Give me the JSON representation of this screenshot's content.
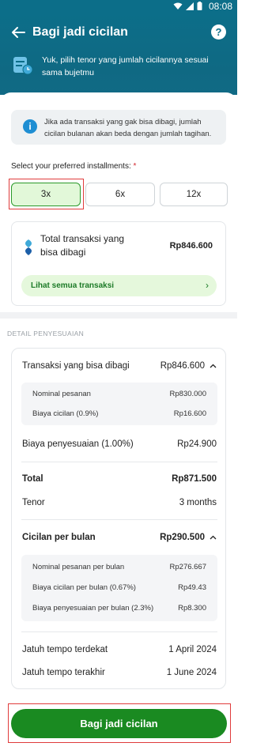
{
  "status_bar": {
    "time": "08:08"
  },
  "header": {
    "title": "Bagi jadi cicilan",
    "help_label": "?",
    "subtitle": "Yuk, pilih tenor yang jumlah cicilannya sesuai sama bujetmu"
  },
  "info": {
    "icon": "i",
    "text": "Jika ada transaksi yang gak bisa dibagi, jumlah cicilan bulanan akan beda dengan jumlah tagihan."
  },
  "installments": {
    "label": "Select your preferred installments:",
    "required_mark": "*",
    "options": [
      "3x",
      "6x",
      "12x"
    ],
    "selected": "3x"
  },
  "summary": {
    "label": "Total transaksi yang bisa dibagi",
    "amount": "Rp846.600",
    "link_label": "Lihat semua transaksi",
    "link_chevron": "›"
  },
  "detail": {
    "section_label": "DETAIL PENYESUAIAN",
    "splittable_label": "Transaksi yang bisa dibagi",
    "splittable_amount": "Rp846.600",
    "splittable_sub": [
      {
        "label": "Nominal pesanan",
        "value": "Rp830.000"
      },
      {
        "label": "Biaya cicilan (0.9%)",
        "value": "Rp16.600"
      }
    ],
    "adjust_label": "Biaya penyesuaian (1.00%)",
    "adjust_amount": "Rp24.900",
    "total_label": "Total",
    "total_amount": "Rp871.500",
    "tenor_label": "Tenor",
    "tenor_value": "3 months",
    "monthly_label": "Cicilan per bulan",
    "monthly_amount": "Rp290.500",
    "monthly_sub": [
      {
        "label": "Nominal pesanan per bulan",
        "value": "Rp276.667"
      },
      {
        "label": "Biaya cicilan per bulan (0.67%)",
        "value": "Rp49.43"
      },
      {
        "label": "Biaya penyesuaian per bulan (2.3%)",
        "value": "Rp8.300"
      }
    ],
    "due_first_label": "Jatuh tempo terdekat",
    "due_first_value": "1 April 2024",
    "due_last_label": "Jatuh tempo terakhir",
    "due_last_value": "1 June 2024",
    "chevron_up": "^"
  },
  "cta": {
    "label": "Bagi jadi cicilan"
  },
  "colors": {
    "brand": "#0c6e89",
    "accent_green": "#1a8a21",
    "selected_bg": "#e2f8d9",
    "info_blue": "#1e8ed3"
  }
}
